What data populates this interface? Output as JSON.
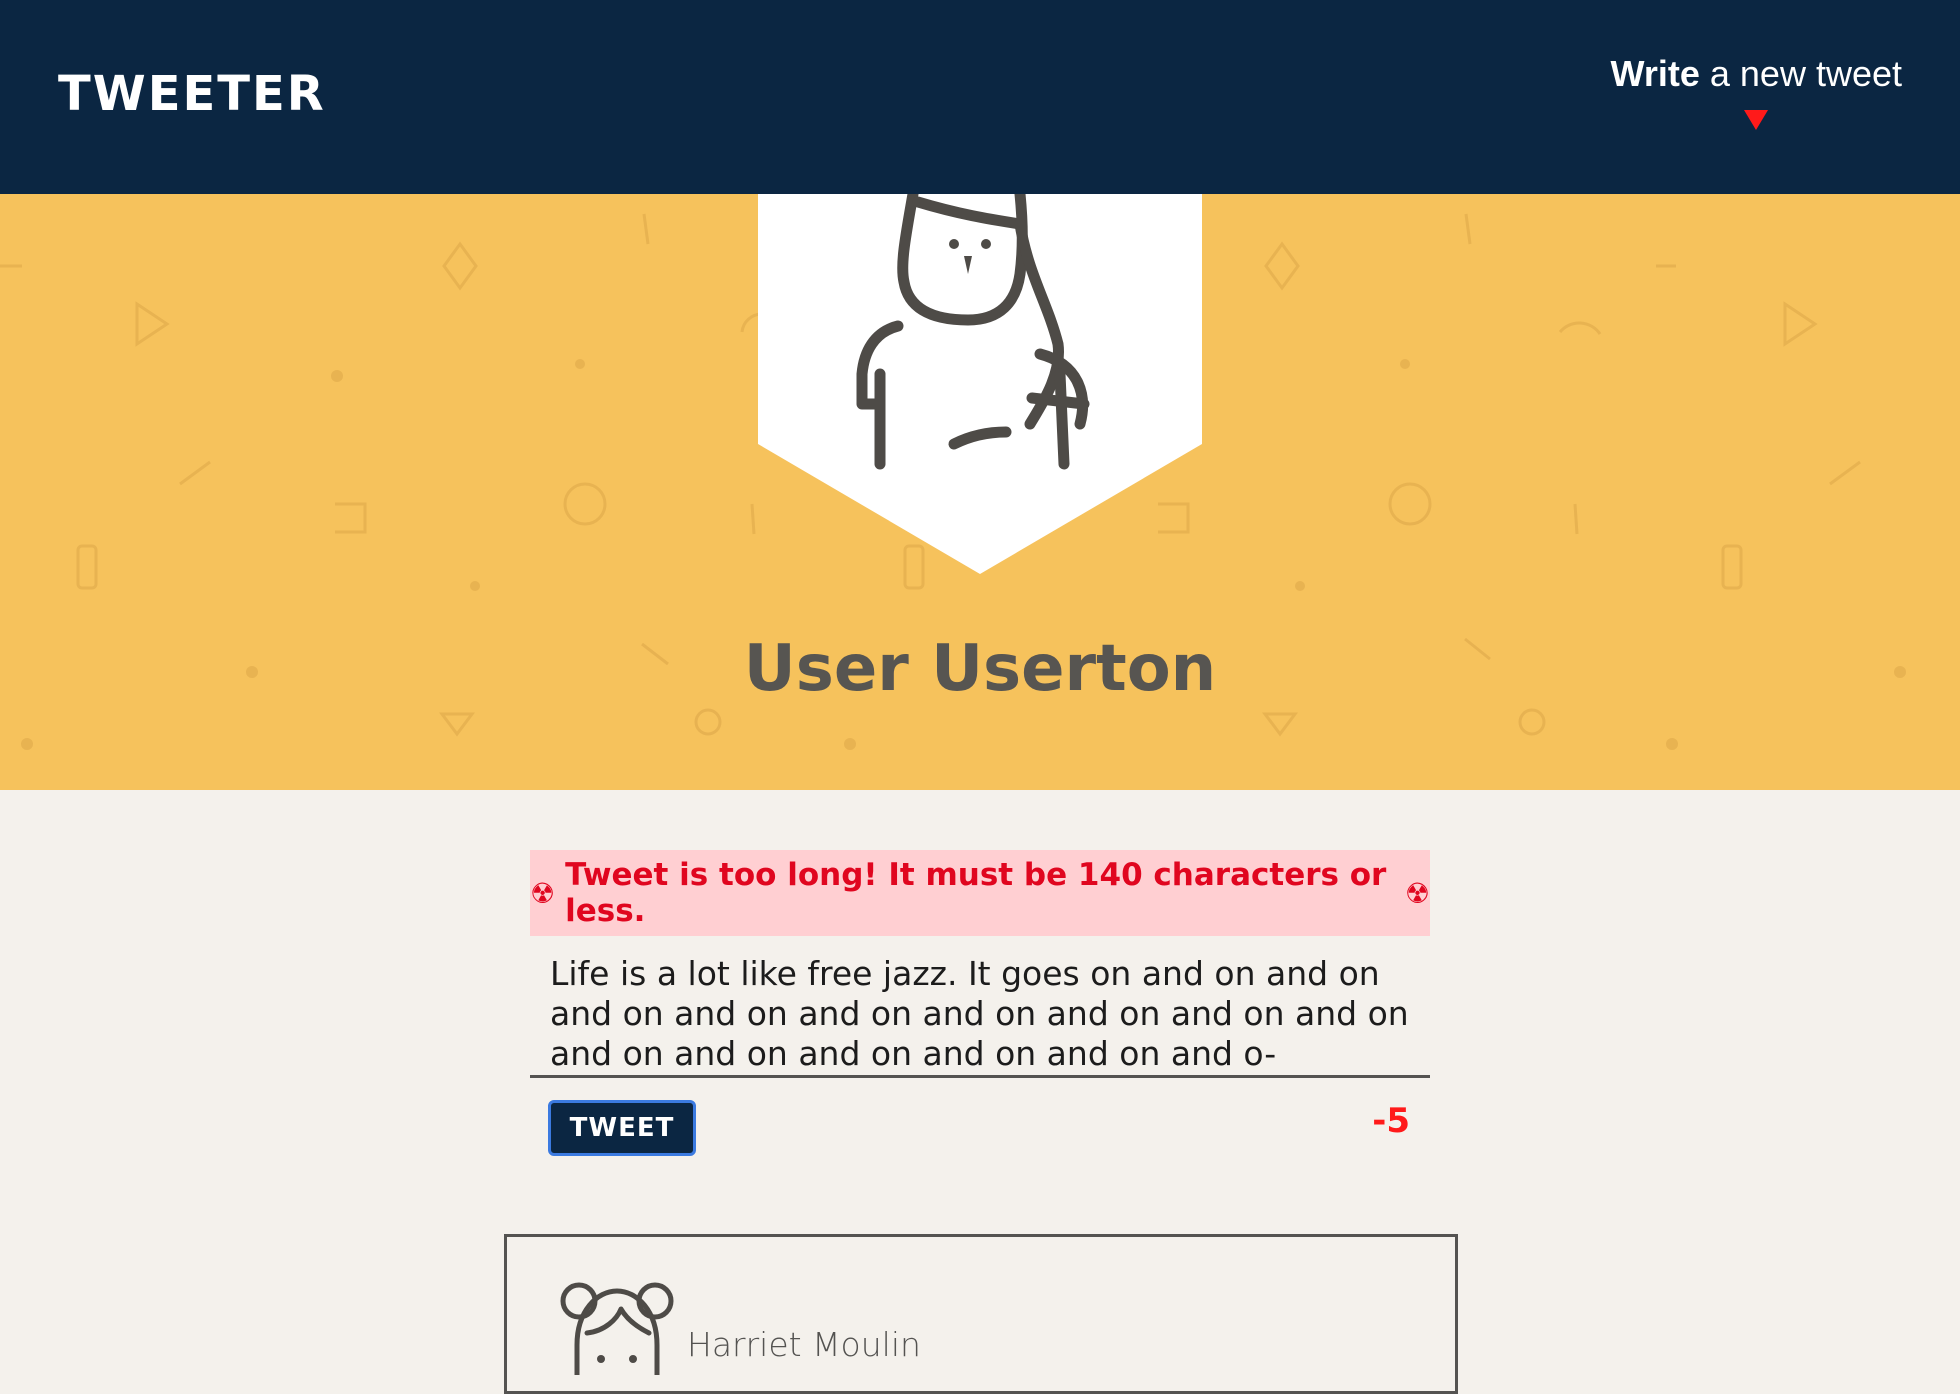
{
  "nav": {
    "brand": "TWEETER",
    "compose_bold": "Write",
    "compose_rest": " a new tweet"
  },
  "profile": {
    "name": "User Userton"
  },
  "compose": {
    "error_message": "Tweet is too long! It must be 140 characters or less.",
    "tweet_text": "Life is a lot like free jazz. It goes on and on and on and on and on and on and on and on and on and on and on and on and on and on and on and o-",
    "button_label": "TWEET",
    "char_count": "-5"
  },
  "tweets": [
    {
      "author": "Harriet Moulin"
    }
  ],
  "colors": {
    "nav_bg": "#0b2642",
    "header_bg": "#f6c25c",
    "page_bg": "#f4f1ec",
    "error_text": "#e0061f",
    "error_bg": "#ffcfd2",
    "counter_red": "#ff1a1a"
  },
  "icons": {
    "compose_arrow": "arrow-down-icon",
    "error_prefix": "hazard-icon",
    "error_suffix": "hazard-icon"
  }
}
